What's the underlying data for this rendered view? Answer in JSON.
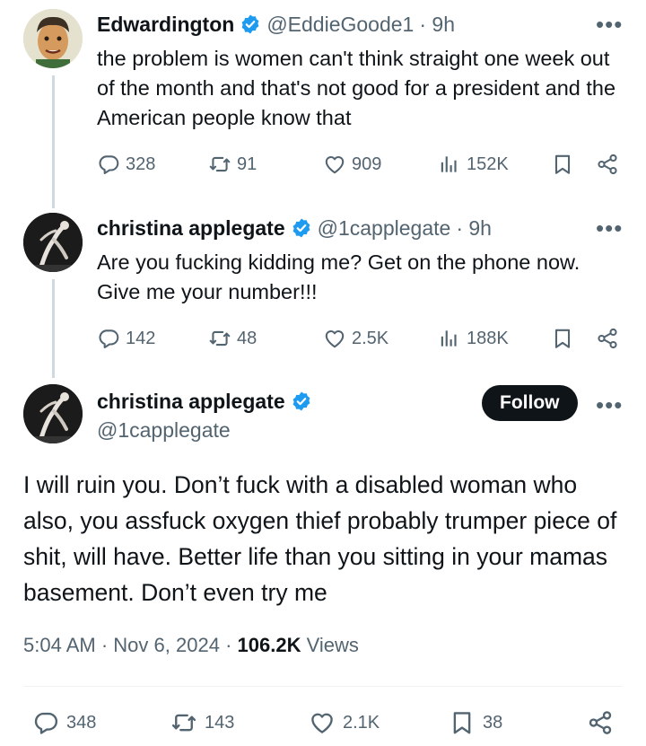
{
  "tweet1": {
    "name": "Edwardington",
    "handle": "@EddieGoode1",
    "time": "· 9h",
    "text": "the problem is women can't think straight one week out of the month and that's not good for a president and the American people know that",
    "replies": "328",
    "reposts": "91",
    "likes": "909",
    "views": "152K"
  },
  "tweet2": {
    "name": "christina applegate",
    "handle": "@1capplegate",
    "time": "· 9h",
    "text": "Are you fucking kidding me? Get on the phone now. Give me your number!!!",
    "replies": "142",
    "reposts": "48",
    "likes": "2.5K",
    "views": "188K"
  },
  "main": {
    "name": "christina applegate",
    "handle": "@1capplegate",
    "follow_label": "Follow",
    "text": "I will ruin you. Don’t fuck with a disabled woman who also, you assfuck oxygen thief probably trumper piece of shit, will have. Better life than you sitting in your mamas basement. Don’t even try me",
    "time": "5:04 AM",
    "date": "Nov 6, 2024",
    "views_count": "106.2K",
    "views_label": "Views",
    "replies": "348",
    "reposts": "143",
    "likes": "2.1K",
    "bookmarks": "38"
  },
  "ui": {
    "more_label": "•••",
    "dot": "·",
    "verified_color": "#1d9bf0",
    "icon_color": "#536471"
  }
}
